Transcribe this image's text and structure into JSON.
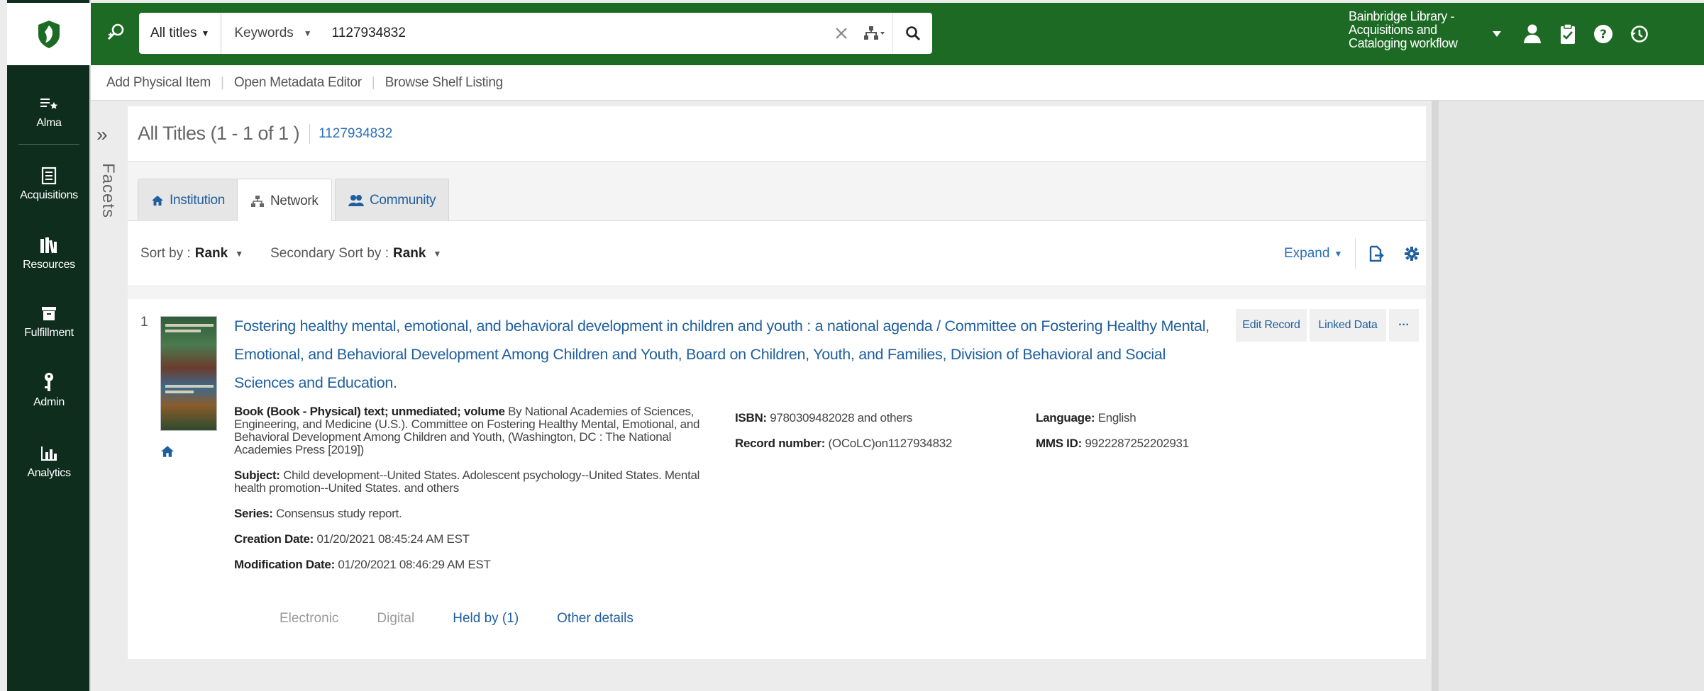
{
  "sidebar": {
    "items": [
      {
        "label": "Alma",
        "icon": "star-list-icon"
      },
      {
        "label": "Acquisitions",
        "icon": "ledger-icon"
      },
      {
        "label": "Resources",
        "icon": "books-icon"
      },
      {
        "label": "Fulfillment",
        "icon": "archive-box-icon"
      },
      {
        "label": "Admin",
        "icon": "key-icon"
      },
      {
        "label": "Analytics",
        "icon": "bar-chart-icon"
      }
    ]
  },
  "topbar": {
    "search_scope": "All titles",
    "search_field": "Keywords",
    "search_value": "1127934832",
    "context": "Bainbridge Library - Acquisitions and Cataloging workflow"
  },
  "actionbar": {
    "add_physical": "Add Physical Item",
    "open_metadata": "Open Metadata Editor",
    "browse_shelf": "Browse Shelf Listing"
  },
  "facets": {
    "label": "Facets",
    "collapse_glyph": "»"
  },
  "results": {
    "count_label": "All Titles (1 - 1 of 1 )",
    "query": "1127934832"
  },
  "tabs": [
    {
      "label": "Institution",
      "active": false
    },
    {
      "label": "Network",
      "active": true
    },
    {
      "label": "Community",
      "active": false
    }
  ],
  "sort": {
    "sort_by_label": "Sort by :",
    "sort_by_value": "Rank",
    "secondary_label": "Secondary Sort by :",
    "secondary_value": "Rank",
    "expand_label": "Expand"
  },
  "record": {
    "number": "1",
    "title": "Fostering healthy mental, emotional, and behavioral development in children and youth : a national agenda / Committee on Fostering Healthy Mental, Emotional, and Behavioral Development Among Children and Youth, Board on Children, Youth, and Families, Division of Behavioral and Social Sciences and Education.",
    "format_label": "Book (Book - Physical) text; unmediated; volume",
    "author_publisher": "By National Academies of Sciences, Engineering, and Medicine (U.S.). Committee on Fostering Healthy Mental, Emotional, and Behavioral Development Among Children and Youth, (Washington, DC : The National Academies Press [2019])",
    "subject_label": "Subject:",
    "subject_value": "Child development--United States. Adolescent psychology--United States. Mental health promotion--United States. and others",
    "series_label": "Series:",
    "series_value": "Consensus study report.",
    "creation_label": "Creation Date:",
    "creation_value": "01/20/2021 08:45:24 AM EST",
    "modification_label": "Modification Date:",
    "modification_value": "01/20/2021 08:46:29 AM EST",
    "isbn_label": "ISBN:",
    "isbn_value": "9780309482028 and others",
    "record_number_label": "Record number:",
    "record_number_value": "(OCoLC)on1127934832",
    "language_label": "Language:",
    "language_value": "English",
    "mms_label": "MMS ID:",
    "mms_value": "9922287252202931",
    "links": {
      "electronic": "Electronic",
      "digital": "Digital",
      "held_by": "Held by (1)",
      "other_details": "Other details"
    },
    "buttons": {
      "edit_record": "Edit Record",
      "linked_data": "Linked Data",
      "more": "···"
    }
  },
  "colors": {
    "topbar_green": "#1d6a24",
    "sidebar_dark": "#0e2d1d",
    "link_blue": "#1f5f9e"
  }
}
